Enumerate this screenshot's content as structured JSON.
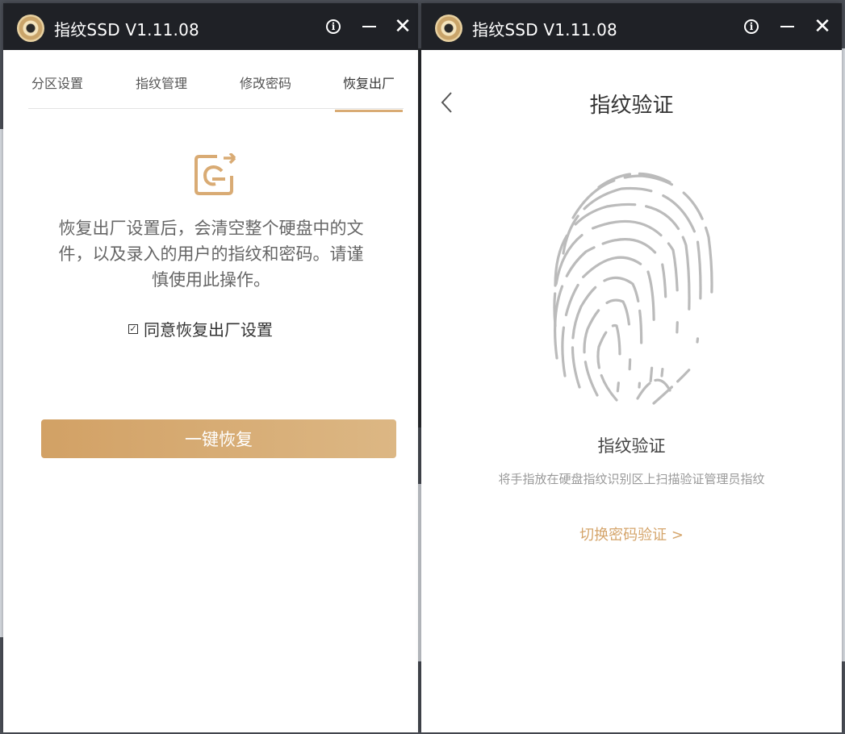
{
  "left_window": {
    "title": "指纹SSD V1.11.08",
    "tabs": [
      {
        "label": "分区设置",
        "active": false
      },
      {
        "label": "指纹管理",
        "active": false
      },
      {
        "label": "修改密码",
        "active": false
      },
      {
        "label": "恢复出厂",
        "active": true
      }
    ],
    "icon": "reset-icon",
    "warning_text": "恢复出厂设置后，会清空整个硬盘中的文件，以及录入的用户的指纹和密码。请谨慎使用此操作。",
    "agree_checked": true,
    "agree_label": "同意恢复出厂设置",
    "reset_button": "一键恢复"
  },
  "right_window": {
    "title": "指纹SSD V1.11.08",
    "page_title": "指纹验证",
    "fingerprint_caption": "指纹验证",
    "hint": "将手指放在硬盘指纹识别区上扫描验证管理员指纹",
    "switch_link": "切换密码验证 >"
  },
  "colors": {
    "titlebar": "#1f2126",
    "accent": "#d9ab74",
    "button_gradient_start": "#d2a165",
    "button_gradient_end": "#dcb784",
    "fingerprint_gray": "#bbbbbb"
  }
}
